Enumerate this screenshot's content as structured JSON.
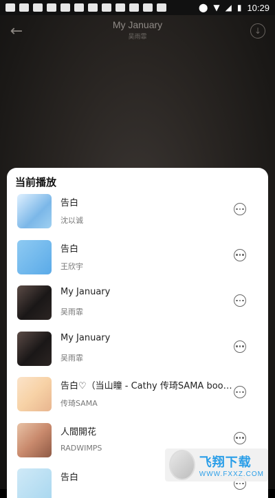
{
  "status_bar": {
    "time": "10:29"
  },
  "header": {
    "title": "My January",
    "subtitle": "吴雨霏"
  },
  "sheet": {
    "title": "当前播放",
    "items": [
      {
        "song": "告白",
        "artist": "沈以诚"
      },
      {
        "song": "告白",
        "artist": "王欣宇"
      },
      {
        "song": "My January",
        "artist": "吴雨霏"
      },
      {
        "song": "My January",
        "artist": "吴雨霏"
      },
      {
        "song": "告白♡（当山瞳 - Cathy 传琦SAMA bootle...",
        "artist": "传琦SAMA"
      },
      {
        "song": "人間開花",
        "artist": "RADWIMPS"
      },
      {
        "song": "告白",
        "artist": ""
      }
    ]
  },
  "watermark": {
    "text_cn": "飞翔下载",
    "text_en": "WWW.FXXZ.COM"
  },
  "colors": {
    "background": "#1b1917",
    "sheet": "#ffffff",
    "watermark_text": "#2a9ee8"
  }
}
